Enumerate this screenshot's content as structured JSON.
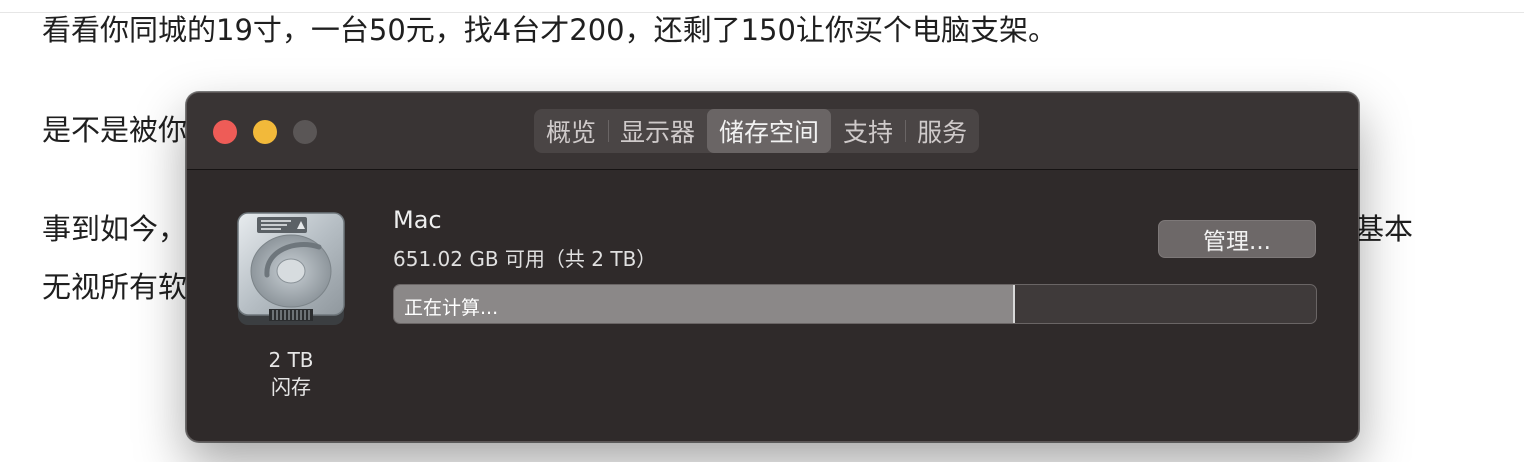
{
  "background": {
    "line1": "看看你同城的19寸，一台50元，找4台才200，还剩了150让你买个电脑支架。",
    "line2": "是不是被你",
    "line3_left": "事到如今，",
    "line3_right": "基本",
    "line4": "无视所有软"
  },
  "window": {
    "tabs": [
      {
        "label": "概览",
        "active": false
      },
      {
        "label": "显示器",
        "active": false
      },
      {
        "label": "储存空间",
        "active": true
      },
      {
        "label": "支持",
        "active": false
      },
      {
        "label": "服务",
        "active": false
      }
    ],
    "drive": {
      "icon": "hard-drive-icon",
      "capacity": "2 TB",
      "type": "闪存"
    },
    "volume": {
      "name": "Mac",
      "detail": "651.02 GB 可用（共 2 TB）"
    },
    "manage_label": "管理...",
    "usage_bar": {
      "label": "正在计算...",
      "fraction": 0.674
    }
  },
  "colors": {
    "close": "#ee5c57",
    "minimize": "#f2b93a",
    "maximize": "#5a5656"
  }
}
